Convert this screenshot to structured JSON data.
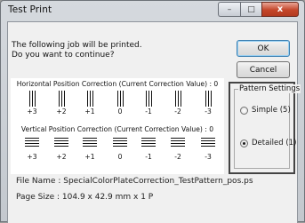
{
  "window": {
    "title": "Test Print",
    "controls": {
      "minimize": "–",
      "maximize": "□",
      "close": "x"
    }
  },
  "message": {
    "line1": "The following job will be printed.",
    "line2": "Do you want to continue?"
  },
  "buttons": {
    "ok": "OK",
    "cancel": "Cancel"
  },
  "pattern": {
    "horizontal_title": "Horizontal Position Correction (Current Correction Value) :  0",
    "vertical_title": "Vertical Position Correction (Current Correction Value) :  0",
    "horizontal_labels": [
      "+3",
      "+2",
      "+1",
      "0",
      "-1",
      "-2",
      "-3"
    ],
    "vertical_labels": [
      "+3",
      "+2",
      "+1",
      "0",
      "-1",
      "-2",
      "-3"
    ]
  },
  "settings": {
    "label": "Pattern Settings",
    "options": [
      {
        "label": "Simple (5)",
        "selected": false
      },
      {
        "label": "Detailed (1)",
        "selected": true
      }
    ]
  },
  "file": {
    "name_label": "File Name :",
    "name_value": "SpecialColorPlateCorrection_TestPattern_pos.ps",
    "size_label": "Page Size :",
    "size_value": "104.9 x 42.9 mm x 1 P"
  }
}
